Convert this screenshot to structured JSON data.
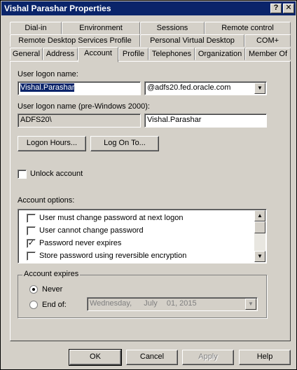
{
  "window": {
    "title": "Vishal Parashar Properties",
    "help_button": "?",
    "close_button": "✕"
  },
  "tabs": {
    "row1": [
      "Dial-in",
      "Environment",
      "Sessions",
      "Remote control"
    ],
    "row2": [
      "Remote Desktop Services Profile",
      "Personal Virtual Desktop",
      "COM+"
    ],
    "row3": [
      "General",
      "Address",
      "Account",
      "Profile",
      "Telephones",
      "Organization",
      "Member Of"
    ],
    "active": "Account"
  },
  "account": {
    "logon_name_label": "User logon name:",
    "logon_name_value": "Vishal.Parashar",
    "domain_value": "@adfs20.fed.oracle.com",
    "pre2000_label": "User logon name (pre-Windows 2000):",
    "pre2000_domain": "ADFS20\\",
    "pre2000_name": "Vishal.Parashar",
    "logon_hours_button": "Logon Hours...",
    "log_on_to_button": "Log On To...",
    "unlock_label": "Unlock account",
    "unlock_checked": false,
    "options_label": "Account options:",
    "options": [
      {
        "label": "User must change password at next logon",
        "checked": false
      },
      {
        "label": "User cannot change password",
        "checked": false
      },
      {
        "label": "Password never expires",
        "checked": true
      },
      {
        "label": "Store password using reversible encryption",
        "checked": false
      }
    ],
    "expires_group": "Account expires",
    "never_label": "Never",
    "end_of_label": "End of:",
    "expires_selected": "Never",
    "date": {
      "weekday": "Wednesday,",
      "month": "July",
      "day": "01, 2015"
    }
  },
  "footer": {
    "ok": "OK",
    "cancel": "Cancel",
    "apply": "Apply",
    "help": "Help"
  },
  "glyphs": {
    "check": "✓",
    "dropdown": "▼",
    "scroll_up": "▲",
    "scroll_down": "▼"
  }
}
